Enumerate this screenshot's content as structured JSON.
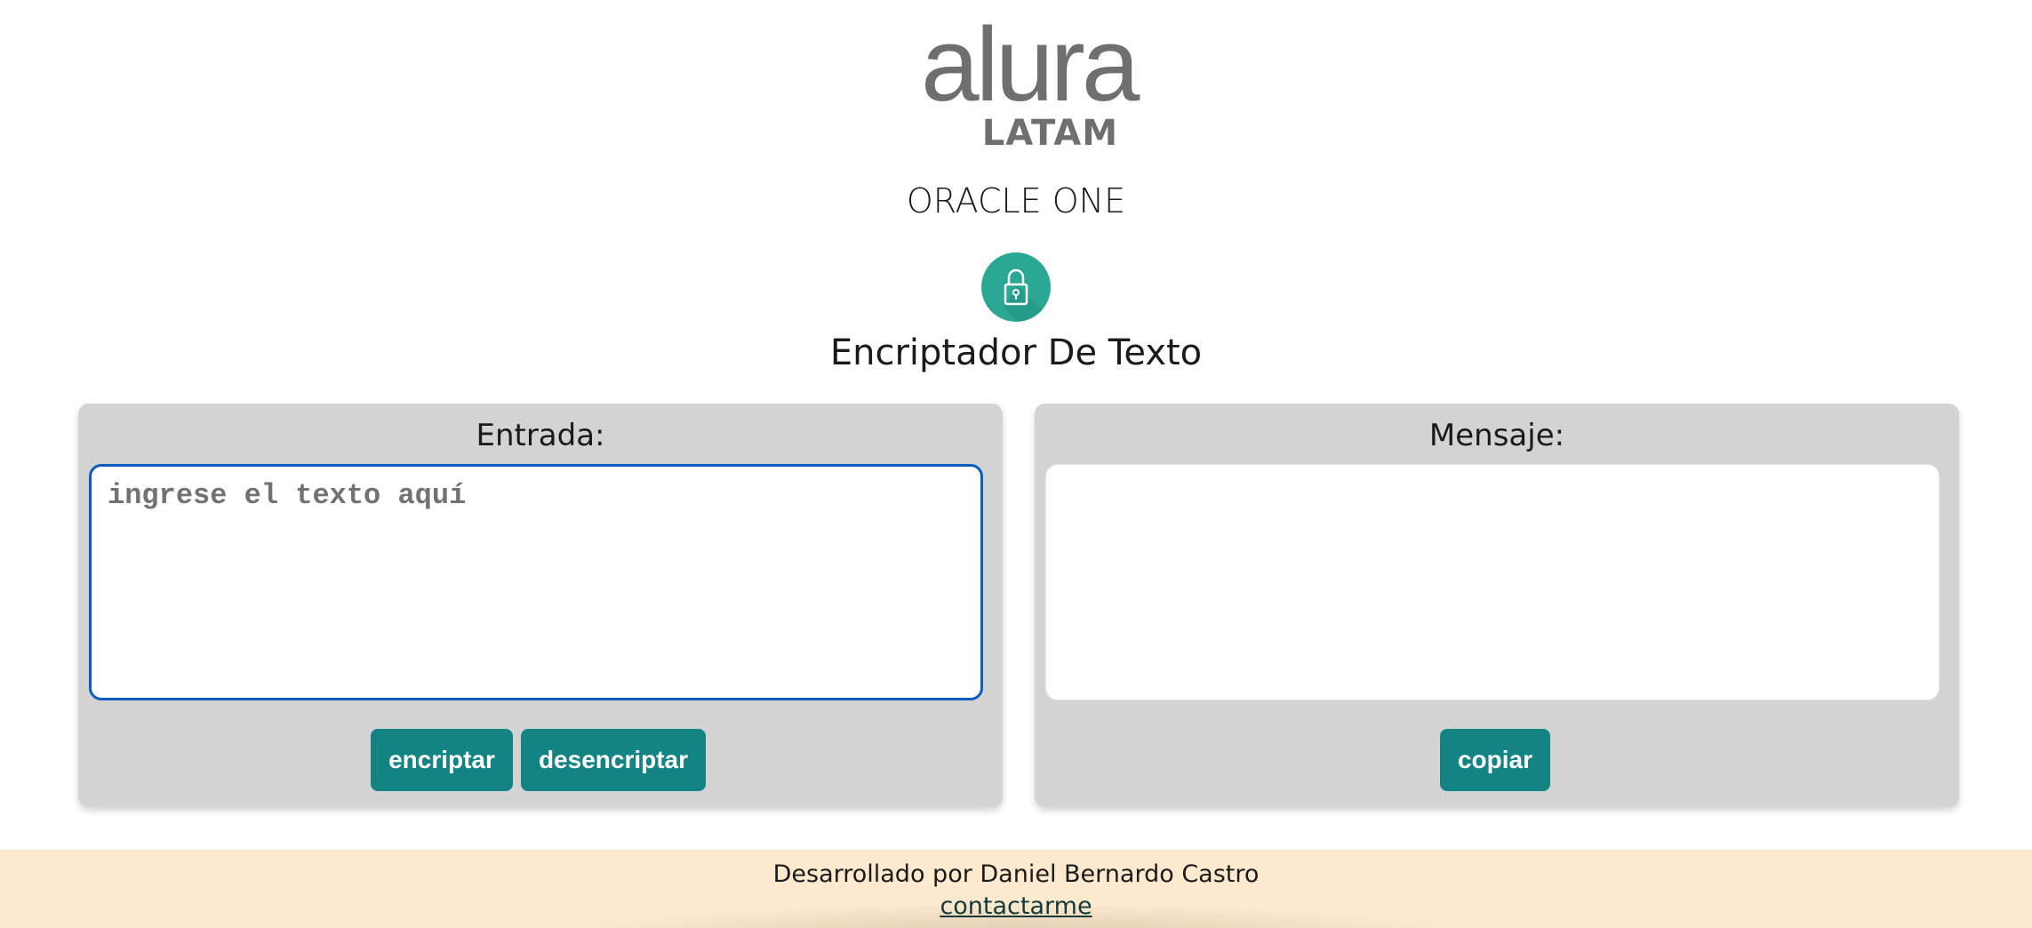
{
  "header": {
    "logo_main": "alura",
    "logo_sub": "LATAM",
    "program": "ORACLE ONE",
    "app_title": "Encriptador De Texto",
    "lock_icon": "lock-icon",
    "accent_color": "#2aa894"
  },
  "input_panel": {
    "label": "Entrada:",
    "value": "",
    "placeholder": "ingrese el texto aquí",
    "encrypt_label": "encriptar",
    "decrypt_label": "desencriptar"
  },
  "output_panel": {
    "label": "Mensaje:",
    "value": "",
    "copy_label": "copiar"
  },
  "buttons": {
    "color": "#148383"
  },
  "footer": {
    "credit": "Desarrollado por Daniel Bernardo Castro",
    "contact_label": "contactarme",
    "background": "#fde9cd"
  }
}
